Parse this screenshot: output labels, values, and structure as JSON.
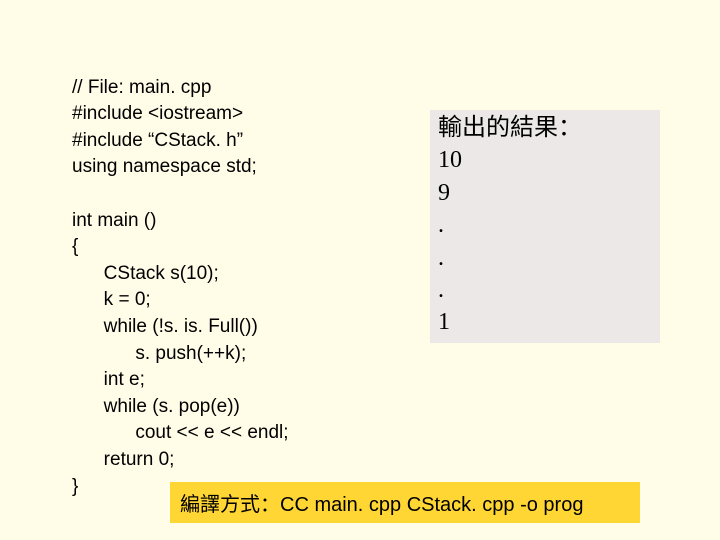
{
  "code": {
    "lines": [
      "// File: main. cpp",
      "#include <iostream>",
      "#include “CStack. h”",
      "using namespace std;",
      "",
      "int main ()",
      "{",
      "      CStack s(10);",
      "      k = 0;",
      "      while (!s. is. Full())",
      "            s. push(++k);",
      "      int e;",
      "      while (s. pop(e))",
      "            cout << e << endl;",
      "      return 0;",
      "}"
    ]
  },
  "output": {
    "title": "輸出的結果：",
    "lines": [
      "10",
      "9",
      ".",
      ".",
      ".",
      "1"
    ]
  },
  "compile": {
    "label": "編譯方式：CC main. cpp CStack. cpp -o prog"
  }
}
